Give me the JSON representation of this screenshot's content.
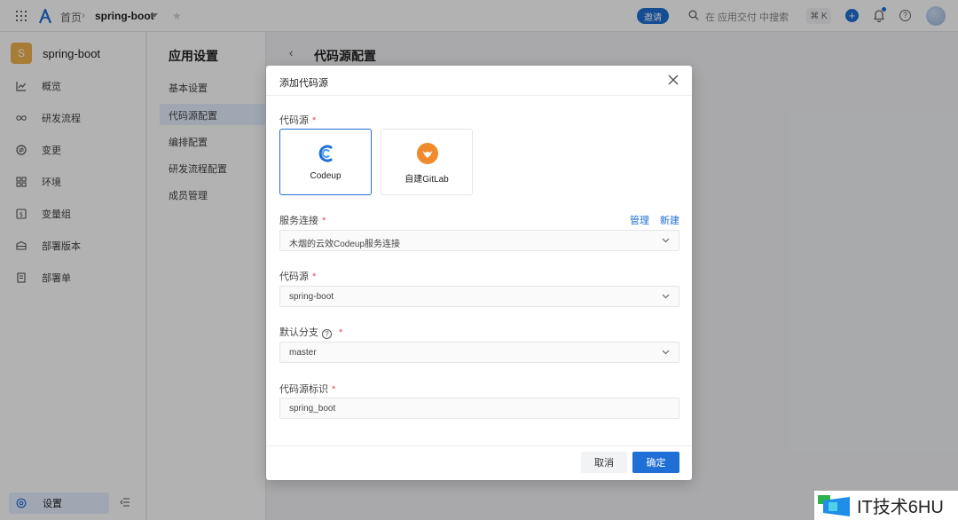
{
  "topbar": {
    "home": "首页",
    "app": "spring-boot",
    "invite": "邀请",
    "search_placeholder": "在 应用交付 中搜索",
    "shortcut": "⌘ K"
  },
  "sidebar": {
    "app_initial": "S",
    "app_name": "spring-boot",
    "items": [
      {
        "label": "概览",
        "icon": "chart-line-icon"
      },
      {
        "label": "研发流程",
        "icon": "infinity-icon"
      },
      {
        "label": "变更",
        "icon": "change-icon"
      },
      {
        "label": "环境",
        "icon": "grid-icon"
      },
      {
        "label": "变量组",
        "icon": "variable-icon"
      },
      {
        "label": "部署版本",
        "icon": "box-icon"
      },
      {
        "label": "部署单",
        "icon": "document-icon"
      }
    ],
    "settings": "设置"
  },
  "settings_panel": {
    "title": "应用设置",
    "items": [
      "基本设置",
      "代码源配置",
      "编排配置",
      "研发流程配置",
      "成员管理"
    ],
    "active_index": 1
  },
  "content": {
    "title": "代码源配置"
  },
  "modal": {
    "title": "添加代码源",
    "source_label": "代码源",
    "sources": [
      {
        "label": "Codeup",
        "selected": true
      },
      {
        "label": "自建GitLab",
        "selected": false
      }
    ],
    "service_label": "服务连接",
    "manage": "管理",
    "create": "新建",
    "service_value": "木烟的云效Codeup服务连接",
    "repo_label": "代码源",
    "repo_value": "spring-boot",
    "branch_label": "默认分支",
    "branch_value": "master",
    "id_label": "代码源标识",
    "id_value": "spring_boot",
    "cancel": "取消",
    "ok": "确定"
  },
  "watermark": {
    "text": "IT技术6HU"
  },
  "colors": {
    "primary": "#1f6fd6",
    "required": "#e34d59",
    "app_avatar": "#f0b24e"
  }
}
